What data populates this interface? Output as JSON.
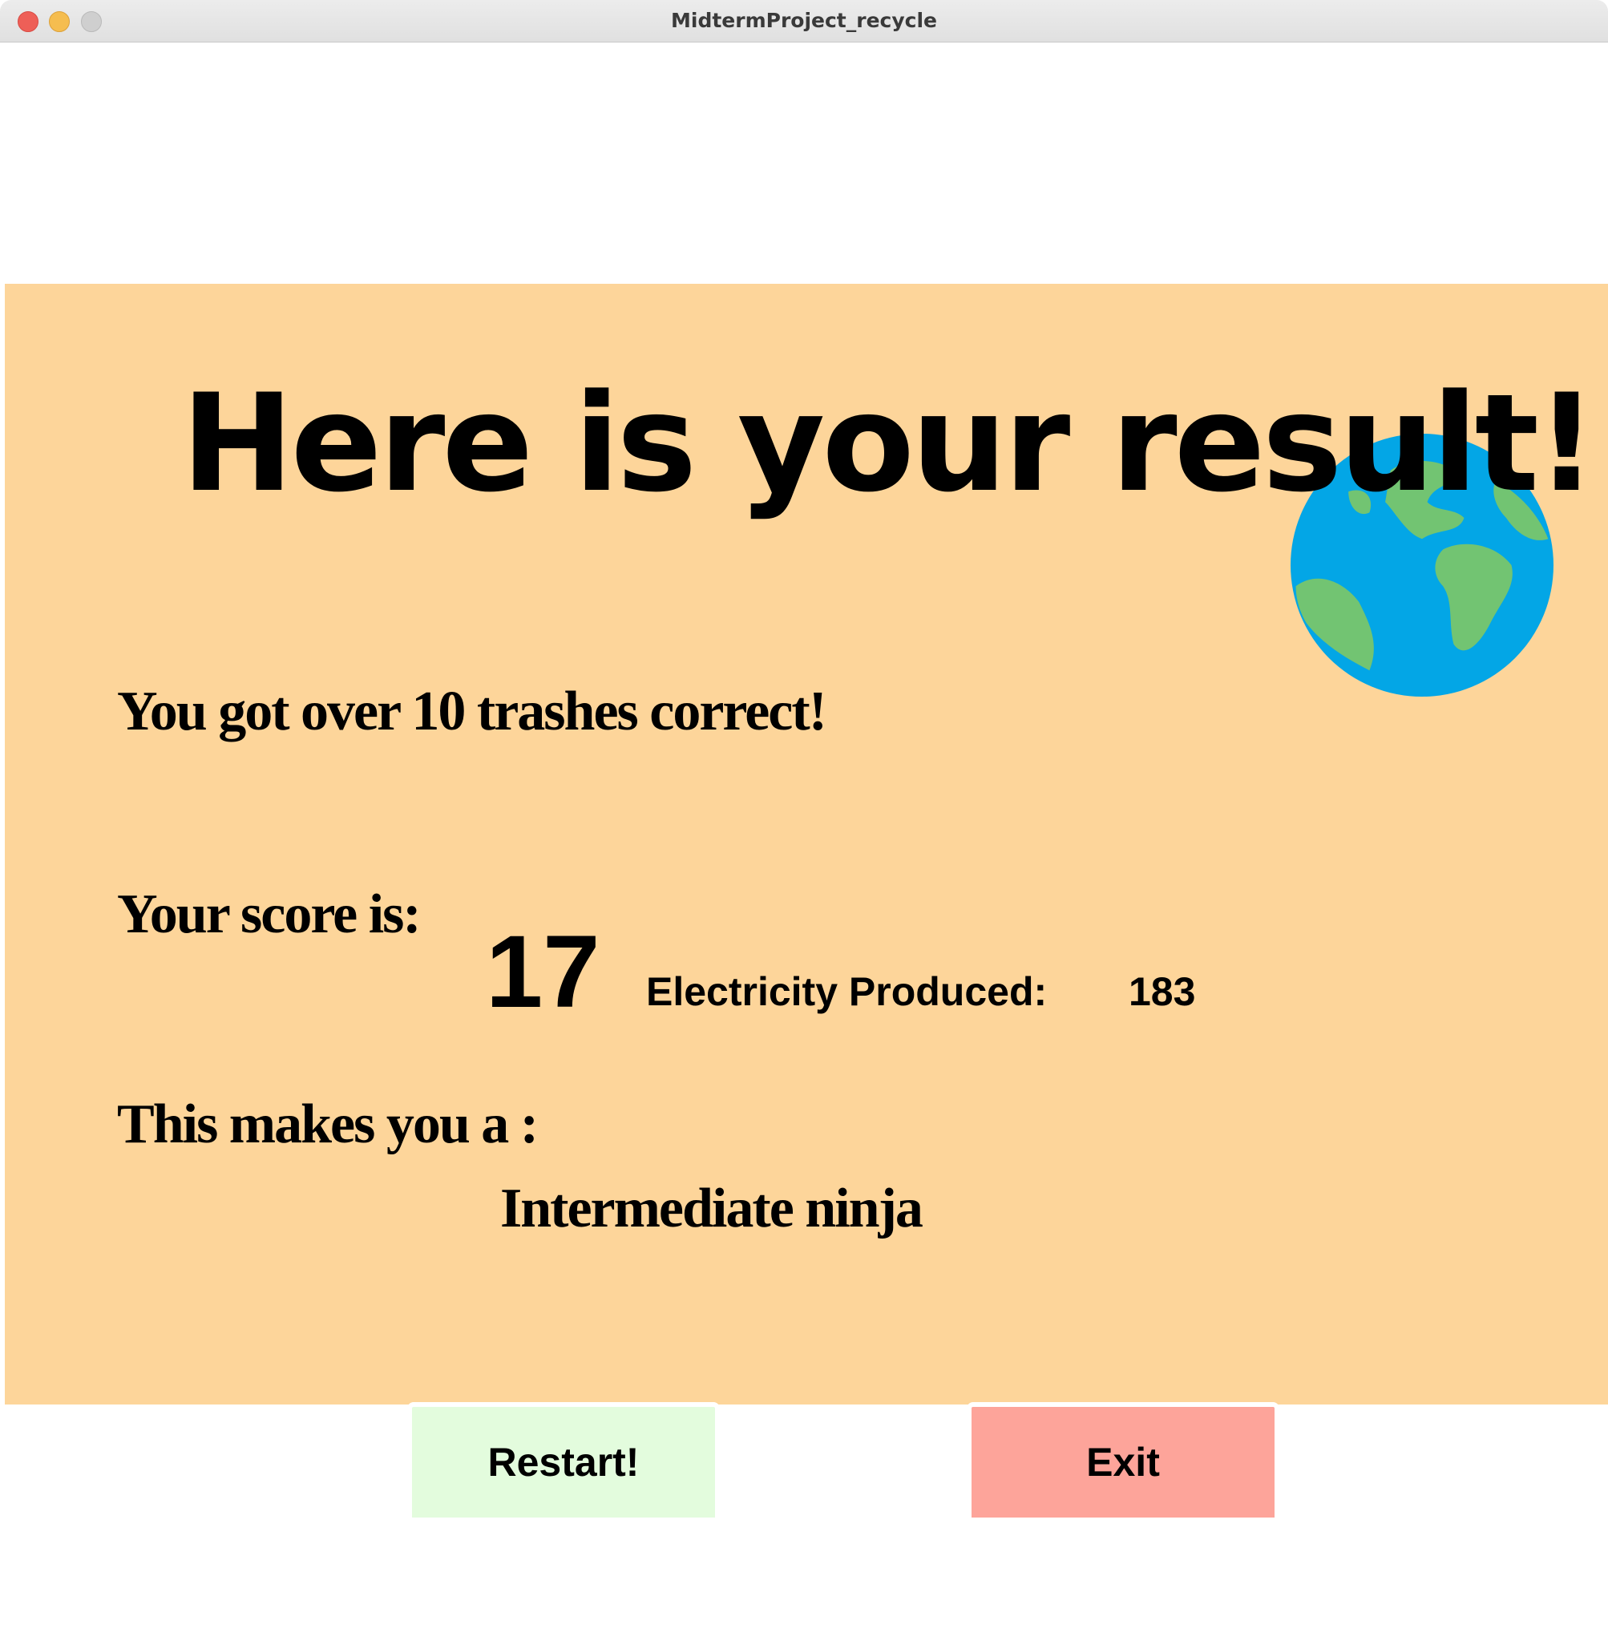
{
  "window": {
    "title": "MidtermProject_recycle"
  },
  "colors": {
    "panel_background": "#fdd59a",
    "restart_button": "#e3fcdd",
    "exit_button": "#fda49a",
    "globe_ocean": "#03a6e6",
    "globe_land": "#72c472"
  },
  "result": {
    "headline": "Here is your result!",
    "correct_message": "You got over 10 trashes correct!",
    "score_label": "Your score is:",
    "score_value": "17",
    "electricity_label": "Electricity Produced:",
    "electricity_value": "183",
    "rank_label": "This makes you a :",
    "rank_value": "Intermediate ninja",
    "globe_icon": "earth-globe-icon"
  },
  "buttons": {
    "restart_label": "Restart!",
    "exit_label": "Exit"
  }
}
